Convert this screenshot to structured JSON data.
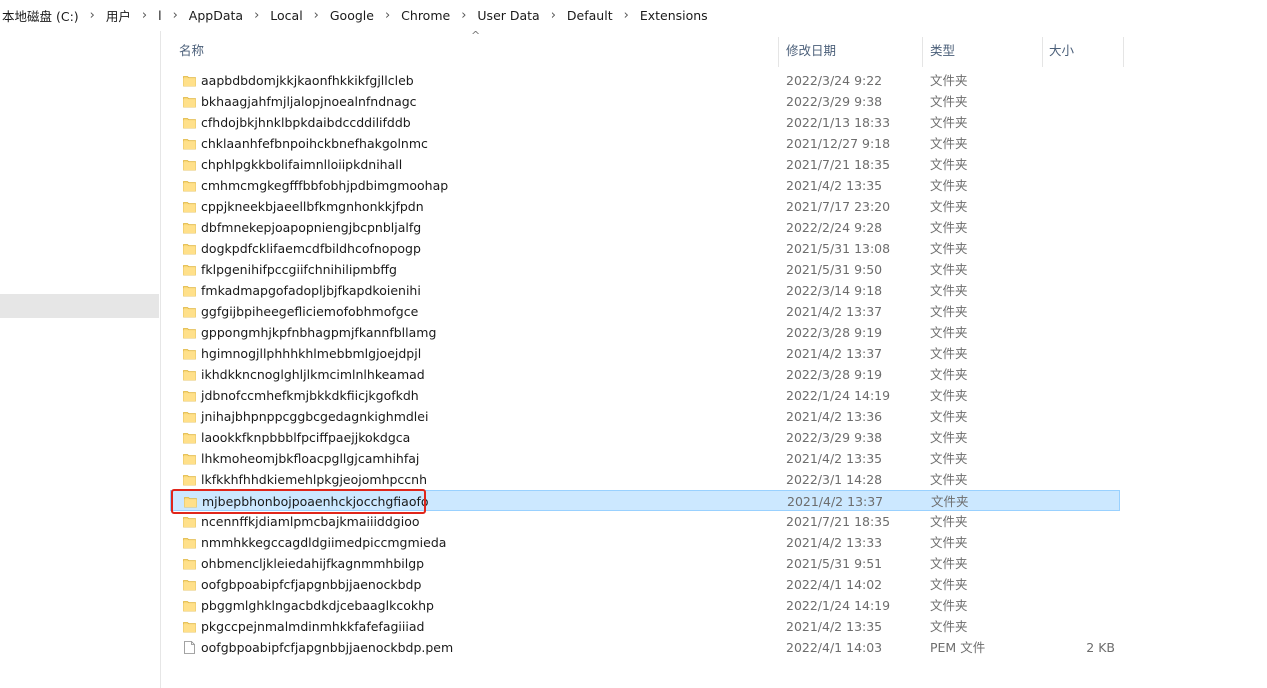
{
  "breadcrumb": [
    "本地磁盘 (C:)",
    "用户",
    "l",
    "AppData",
    "Local",
    "Google",
    "Chrome",
    "User Data",
    "Default",
    "Extensions"
  ],
  "breadcrumb_separator": "›",
  "columns": {
    "name": "名称",
    "date": "修改日期",
    "type": "类型",
    "size": "大小",
    "sort_indicator": "^"
  },
  "colors": {
    "selected_bg": "#cce8ff",
    "highlight_border": "#e0261b",
    "folder": "#f8d775"
  },
  "rows": [
    {
      "name": "aapbdbdomjkkjkaonfhkkikfgjllcleb",
      "date": "2022/3/24 9:22",
      "type": "文件夹",
      "size": "",
      "icon": "folder-icon"
    },
    {
      "name": "bkhaagjahfmjljalopjnoealnfndnagc",
      "date": "2022/3/29 9:38",
      "type": "文件夹",
      "size": "",
      "icon": "folder-icon"
    },
    {
      "name": "cfhdojbkjhnklbpkdaibdccddilifddb",
      "date": "2022/1/13 18:33",
      "type": "文件夹",
      "size": "",
      "icon": "folder-icon"
    },
    {
      "name": "chklaanhfefbnpoihckbnefhakgolnmc",
      "date": "2021/12/27 9:18",
      "type": "文件夹",
      "size": "",
      "icon": "folder-icon"
    },
    {
      "name": "chphlpgkkbolifaimnlloiipkdnihall",
      "date": "2021/7/21 18:35",
      "type": "文件夹",
      "size": "",
      "icon": "folder-icon"
    },
    {
      "name": "cmhmcmgkegfffbbfobhjpdbimgmoohap",
      "date": "2021/4/2 13:35",
      "type": "文件夹",
      "size": "",
      "icon": "folder-icon"
    },
    {
      "name": "cppjkneekbjaeellbfkmgnhonkkjfpdn",
      "date": "2021/7/17 23:20",
      "type": "文件夹",
      "size": "",
      "icon": "folder-icon"
    },
    {
      "name": "dbfmnekepjoapopniengjbcpnbljalfg",
      "date": "2022/2/24 9:28",
      "type": "文件夹",
      "size": "",
      "icon": "folder-icon"
    },
    {
      "name": "dogkpdfcklifaemcdfbildhcofnopogp",
      "date": "2021/5/31 13:08",
      "type": "文件夹",
      "size": "",
      "icon": "folder-icon"
    },
    {
      "name": "fklpgenihifpccgiifchnihilipmbffg",
      "date": "2021/5/31 9:50",
      "type": "文件夹",
      "size": "",
      "icon": "folder-icon"
    },
    {
      "name": "fmkadmapgofadopljbjfkapdkoienihi",
      "date": "2022/3/14 9:18",
      "type": "文件夹",
      "size": "",
      "icon": "folder-icon"
    },
    {
      "name": "ggfgijbpiheegefliciemofobhmofgce",
      "date": "2021/4/2 13:37",
      "type": "文件夹",
      "size": "",
      "icon": "folder-icon"
    },
    {
      "name": "gppongmhjkpfnbhagpmjfkannfbllamg",
      "date": "2022/3/28 9:19",
      "type": "文件夹",
      "size": "",
      "icon": "folder-icon"
    },
    {
      "name": "hgimnogjllphhhkhlmebbmlgjoejdpjl",
      "date": "2021/4/2 13:37",
      "type": "文件夹",
      "size": "",
      "icon": "folder-icon"
    },
    {
      "name": "ikhdkkncnoglghljlkmcimlnlhkeamad",
      "date": "2022/3/28 9:19",
      "type": "文件夹",
      "size": "",
      "icon": "folder-icon"
    },
    {
      "name": "jdbnofccmhefkmjbkkdkfiicjkgofkdh",
      "date": "2022/1/24 14:19",
      "type": "文件夹",
      "size": "",
      "icon": "folder-icon"
    },
    {
      "name": "jnihajbhpnppcggbcgedagnkighmdlei",
      "date": "2021/4/2 13:36",
      "type": "文件夹",
      "size": "",
      "icon": "folder-icon"
    },
    {
      "name": "laookkfknpbbblfpciffpaejjkokdgca",
      "date": "2022/3/29 9:38",
      "type": "文件夹",
      "size": "",
      "icon": "folder-icon"
    },
    {
      "name": "lhkmoheomjbkfloacpgllgjcamhihfaj",
      "date": "2021/4/2 13:35",
      "type": "文件夹",
      "size": "",
      "icon": "folder-icon"
    },
    {
      "name": "lkfkkhfhhdkiemehlpkgjeojomhpccnh",
      "date": "2022/3/1 14:28",
      "type": "文件夹",
      "size": "",
      "icon": "folder-icon"
    },
    {
      "name": "mjbepbhonbojpoaenhckjocchgfiaofo",
      "date": "2021/4/2 13:37",
      "type": "文件夹",
      "size": "",
      "icon": "folder-icon",
      "selected": true
    },
    {
      "name": "ncennffkjdiamlpmcbajkmaiiiddgioo",
      "date": "2021/7/21 18:35",
      "type": "文件夹",
      "size": "",
      "icon": "folder-icon"
    },
    {
      "name": "nmmhkkegccagdldgiimedpiccmgmieda",
      "date": "2021/4/2 13:33",
      "type": "文件夹",
      "size": "",
      "icon": "folder-icon"
    },
    {
      "name": "ohbmencljkleiedahijfkagnmmhbilgp",
      "date": "2021/5/31 9:51",
      "type": "文件夹",
      "size": "",
      "icon": "folder-icon"
    },
    {
      "name": "oofgbpoabipfcfjapgnbbjjaenockbdp",
      "date": "2022/4/1 14:02",
      "type": "文件夹",
      "size": "",
      "icon": "folder-icon"
    },
    {
      "name": "pbggmlghklngacbdkdjcebaaglkcokhp",
      "date": "2022/1/24 14:19",
      "type": "文件夹",
      "size": "",
      "icon": "folder-icon"
    },
    {
      "name": "pkgccpejnmalmdinmhkkfafefagiiiad",
      "date": "2021/4/2 13:35",
      "type": "文件夹",
      "size": "",
      "icon": "folder-icon"
    },
    {
      "name": "oofgbpoabipfcfjapgnbbjjaenockbdp.pem",
      "date": "2022/4/1 14:03",
      "type": "PEM 文件",
      "size": "2 KB",
      "icon": "file-icon"
    }
  ]
}
